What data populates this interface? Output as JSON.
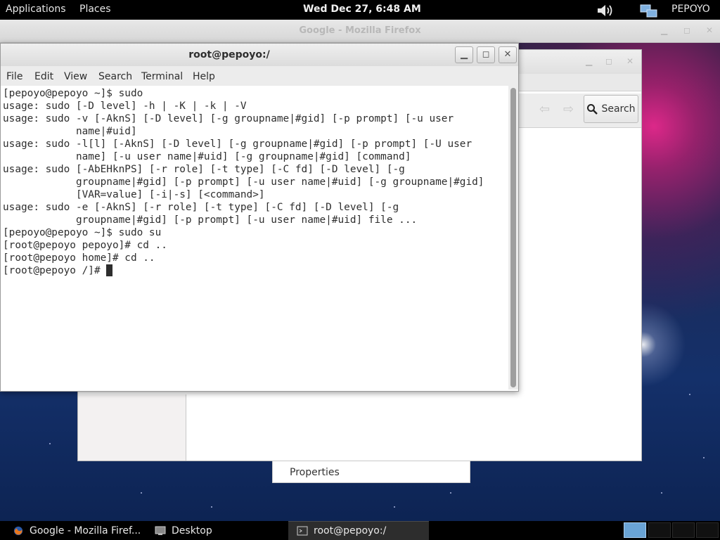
{
  "top_panel": {
    "applications": "Applications",
    "places": "Places",
    "clock": "Wed Dec 27,  6:48 AM",
    "user": "PEPOYO"
  },
  "firefox": {
    "title": "Google - Mozilla Firefox",
    "search_label": "Search"
  },
  "context_menu": {
    "properties": "Properties"
  },
  "terminal": {
    "title": "root@pepoyo:/",
    "menu": [
      "File",
      "Edit",
      "View",
      "Search",
      "Terminal",
      "Help"
    ],
    "lines": [
      "[pepoyo@pepoyo ~]$ sudo",
      "usage: sudo [-D level] -h | -K | -k | -V",
      "usage: sudo -v [-AknS] [-D level] [-g groupname|#gid] [-p prompt] [-u user",
      "            name|#uid]",
      "usage: sudo -l[l] [-AknS] [-D level] [-g groupname|#gid] [-p prompt] [-U user",
      "            name] [-u user name|#uid] [-g groupname|#gid] [command]",
      "usage: sudo [-AbEHknPS] [-r role] [-t type] [-C fd] [-D level] [-g",
      "            groupname|#gid] [-p prompt] [-u user name|#uid] [-g groupname|#gid]",
      "            [VAR=value] [-i|-s] [<command>]",
      "usage: sudo -e [-AknS] [-r role] [-t type] [-C fd] [-D level] [-g",
      "            groupname|#gid] [-p prompt] [-u user name|#uid] file ...",
      "[pepoyo@pepoyo ~]$ sudo su",
      "[root@pepoyo pepoyo]# cd ..",
      "[root@pepoyo home]# cd .."
    ],
    "prompt": "[root@pepoyo /]# "
  },
  "taskbar": {
    "items": [
      "Google - Mozilla Firef...",
      "Desktop",
      "root@pepoyo:/"
    ]
  },
  "colors": {
    "panel": "#000000",
    "terminal_text": "#2e2e2e",
    "workspace_active": "#6aa4d6"
  }
}
